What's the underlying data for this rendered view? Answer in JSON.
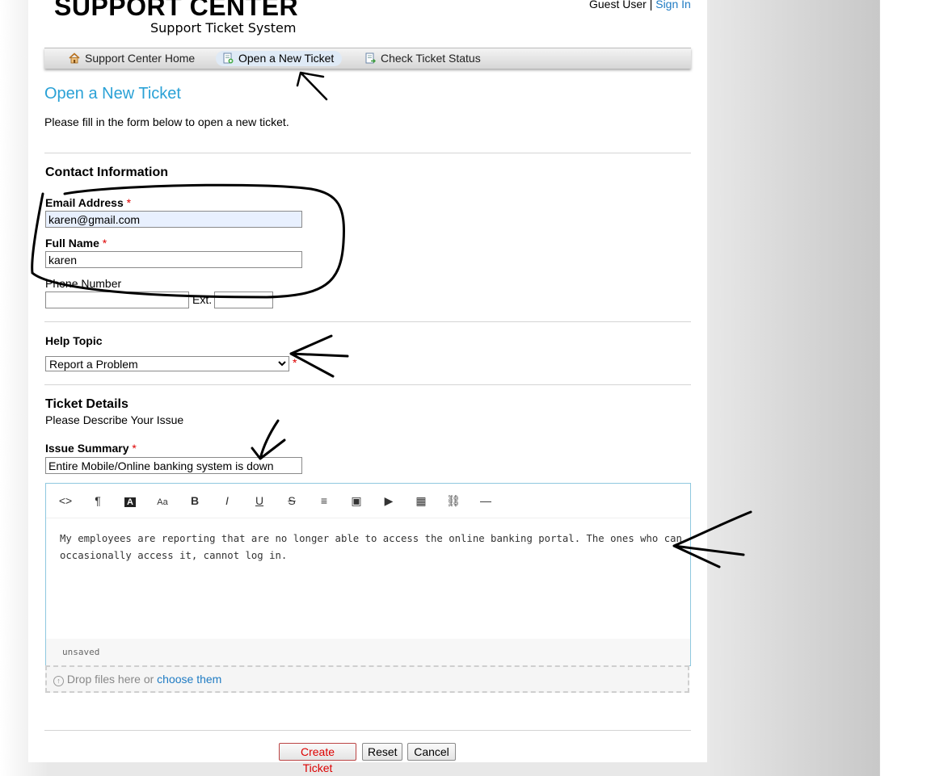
{
  "header": {
    "logo_title": "SUPPORT CENTER",
    "logo_subtitle": "Support Ticket System",
    "welcome_user": "Guest User",
    "welcome_separator": " | ",
    "sign_in": "Sign In"
  },
  "nav": {
    "items": [
      {
        "label": "Support Center Home",
        "icon": "home-icon"
      },
      {
        "label": "Open a New Ticket",
        "icon": "new-ticket-icon",
        "active": true
      },
      {
        "label": "Check Ticket Status",
        "icon": "ticket-status-icon"
      }
    ]
  },
  "page": {
    "title": "Open a New Ticket",
    "intro": "Please fill in the form below to open a new ticket."
  },
  "contact": {
    "section_title": "Contact Information",
    "email_label": "Email Address",
    "email_value": "karen@gmail.com",
    "fullname_label": "Full Name",
    "fullname_value": "karen",
    "phone_label": "Phone Number",
    "phone_value": "",
    "ext_label": "Ext.",
    "ext_value": "",
    "required_mark": "*"
  },
  "help_topic": {
    "label": "Help Topic",
    "selected": "Report a Problem"
  },
  "details": {
    "section_title": "Ticket Details",
    "subtitle": "Please Describe Your Issue",
    "summary_label": "Issue Summary",
    "summary_value": "Entire Mobile/Online banking system is down",
    "toolbar": [
      {
        "glyph": "<>",
        "icon": "html-code-icon"
      },
      {
        "glyph": "¶",
        "icon": "paragraph-icon"
      },
      {
        "glyph": "A",
        "icon": "font-color-icon"
      },
      {
        "glyph": "Aa",
        "icon": "font-size-icon"
      },
      {
        "glyph": "B",
        "icon": "bold-icon"
      },
      {
        "glyph": "I",
        "icon": "italic-icon"
      },
      {
        "glyph": "U",
        "icon": "underline-icon"
      },
      {
        "glyph": "S",
        "icon": "strikethrough-icon"
      },
      {
        "glyph": "≡",
        "icon": "list-icon"
      },
      {
        "glyph": "▣",
        "icon": "image-icon"
      },
      {
        "glyph": "▶",
        "icon": "video-icon"
      },
      {
        "glyph": "▦",
        "icon": "table-icon"
      },
      {
        "glyph": "⛓",
        "icon": "link-icon"
      },
      {
        "glyph": "—",
        "icon": "horizontal-rule-icon"
      }
    ],
    "body_text": "My employees are reporting that are no longer able to access the online banking portal. The ones who can occasionally access it, cannot log in.",
    "status": "unsaved",
    "dropzone_text": "Drop files here or ",
    "dropzone_link": "choose them"
  },
  "buttons": {
    "create": "Create Ticket",
    "reset": "Reset",
    "cancel": "Cancel"
  },
  "colors": {
    "accent": "#2aa1d6",
    "link": "#1f7bc3",
    "required": "#dd0000"
  }
}
